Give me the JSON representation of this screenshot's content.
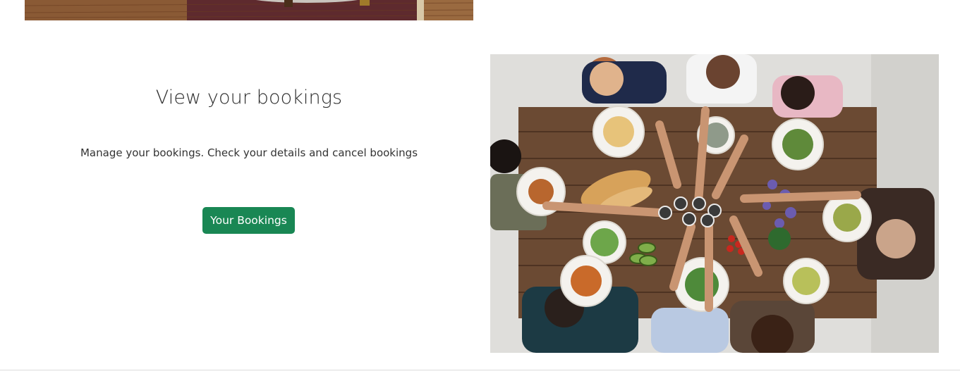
{
  "section": {
    "title": "View your bookings",
    "description": "Manage your bookings. Check your details and cancel bookings",
    "button_label": "Your Bookings"
  },
  "images": {
    "top_image_icon": "food-photo-icon",
    "dining_photo_icon": "group-dining-photo-icon"
  },
  "colors": {
    "accent": "#198754",
    "title_text": "#2c2c2c",
    "body_text": "#333333",
    "table_wood": "#6b4a33"
  }
}
